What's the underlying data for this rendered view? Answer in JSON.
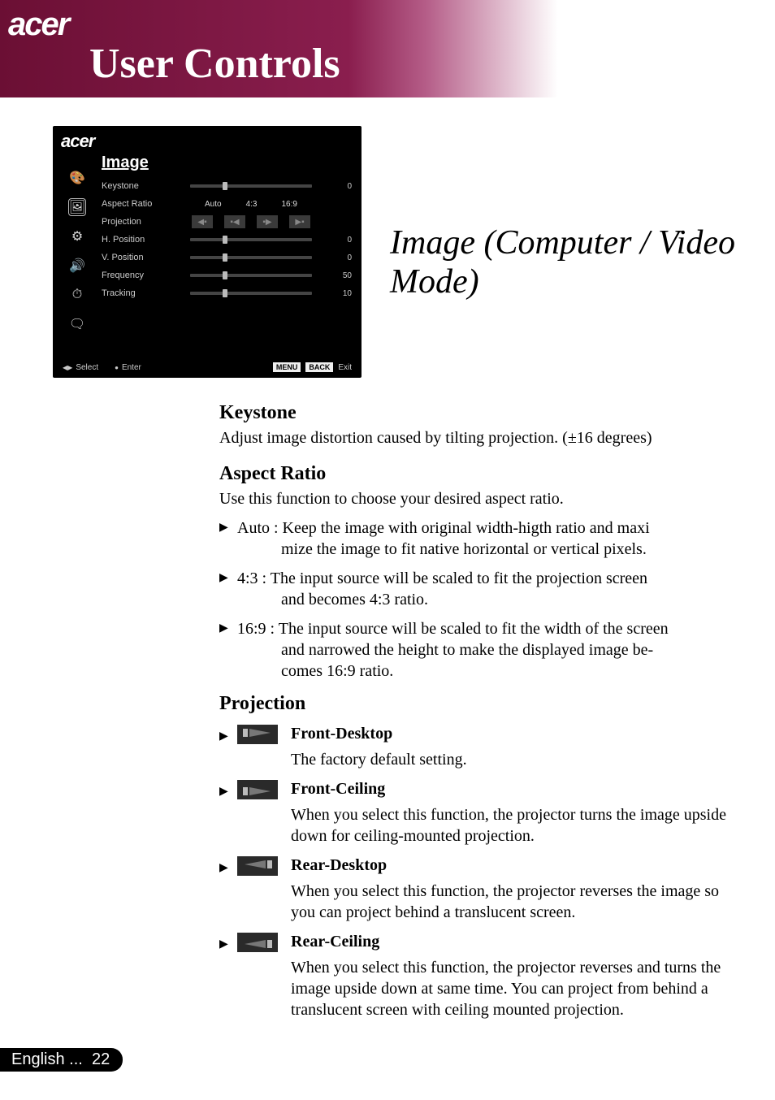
{
  "topbar": {
    "brand": "acer",
    "heading": "User Controls"
  },
  "osd": {
    "brand": "acer",
    "title": "Image",
    "rows": {
      "keystone": {
        "label": "Keystone",
        "value": "0"
      },
      "aspect": {
        "label": "Aspect Ratio",
        "opt_auto": "Auto",
        "opt_43": "4:3",
        "opt_169": "16:9"
      },
      "projection": {
        "label": "Projection"
      },
      "hpos": {
        "label": "H. Position",
        "value": "0"
      },
      "vpos": {
        "label": "V. Position",
        "value": "0"
      },
      "freq": {
        "label": "Frequency",
        "value": "50"
      },
      "track": {
        "label": "Tracking",
        "value": "10"
      }
    },
    "footer": {
      "select": "Select",
      "enter": "Enter",
      "menu": "MENU",
      "back": "BACK",
      "exit": "Exit"
    }
  },
  "section_heading": "Image (Computer / Video Mode)",
  "doc": {
    "keystone_h": "Keystone",
    "keystone_p": "Adjust image distortion caused by tilting projection. (±16 degrees)",
    "aspect_h": "Aspect Ratio",
    "aspect_p": "Use this function to choose your desired aspect ratio.",
    "aspect_li1_a": "Auto : Keep the image with original width-higth ratio and maxi",
    "aspect_li1_b": "mize the image to fit native horizontal or vertical pixels.",
    "aspect_li2_a": "4:3 : The input source will be scaled to fit the projection screen",
    "aspect_li2_b": "and becomes 4:3 ratio.",
    "aspect_li3_a": "16:9 : The input source will be scaled to fit the width of the screen",
    "aspect_li3_b": "and narrowed the height to make the displayed image be-",
    "aspect_li3_c": "comes 16:9 ratio.",
    "proj_h": "Projection",
    "proj_items": {
      "front_desktop": {
        "title": "Front-Desktop",
        "desc": "The factory default setting."
      },
      "front_ceiling": {
        "title": "Front-Ceiling",
        "desc": "When you select this function, the projector turns the image upside down for ceiling-mounted projection."
      },
      "rear_desktop": {
        "title": "Rear-Desktop",
        "desc": "When you select this function, the projector reverses the image  so you can project behind a translucent screen."
      },
      "rear_ceiling": {
        "title": "Rear-Ceiling",
        "desc": "When you select this function, the projector reverses and turns the image upside down at same time. You can project from behind a translucent screen with ceiling mounted projection."
      }
    }
  },
  "footer": {
    "lang": "English ...",
    "page": "22"
  }
}
